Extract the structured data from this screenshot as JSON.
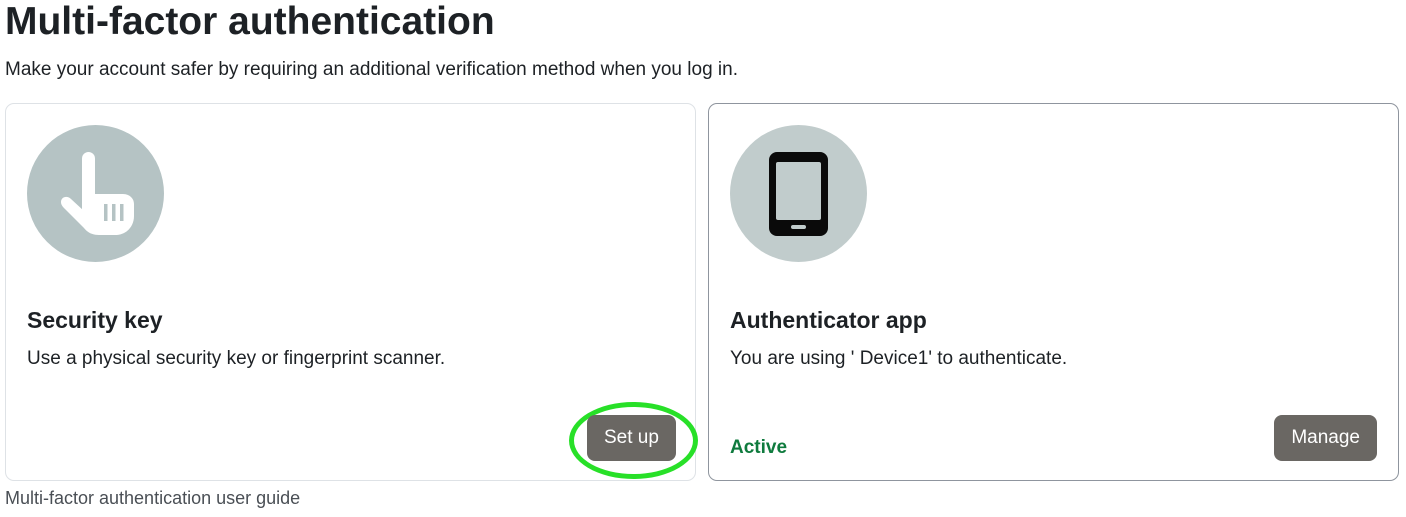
{
  "page": {
    "title": "Multi-factor authentication",
    "subtitle": "Make your account safer by requiring an additional verification method when you log in."
  },
  "cards": [
    {
      "icon": "hand-pointer-icon",
      "title": "Security key",
      "description": "Use a physical security key or fingerprint scanner.",
      "button_label": "Set up"
    },
    {
      "icon": "smartphone-icon",
      "title": "Authenticator app",
      "description": "You are using ' Device1' to authenticate.",
      "status": "Active",
      "button_label": "Manage"
    }
  ],
  "footer": {
    "guide_link": "Multi-factor authentication user guide"
  },
  "colors": {
    "button_bg": "#6a6763",
    "status_active": "#0f7b3e",
    "icon_circle": "#b5c3c4",
    "highlight": "#28e028"
  }
}
